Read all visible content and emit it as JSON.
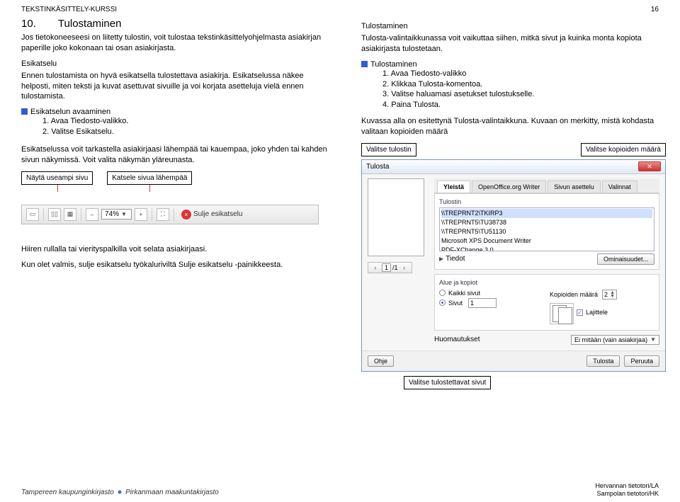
{
  "header": {
    "course": "TEKSTINKÄSITTELY-KURSSI",
    "page": "16"
  },
  "section": {
    "number": "10.",
    "title": "Tulostaminen",
    "intro": "Jos tietokoneeseesi on liitetty tulostin, voit tulostaa tekstinkäsittelyohjelmasta asiakirjan paperille joko kokonaan tai osan asiakirjasta."
  },
  "esikatselu": {
    "heading": "Esikatselu",
    "p1": "Ennen tulostamista on hyvä esikatsella tulostettava asiakirja. Esikatselussa näkee helposti, miten teksti ja kuvat asettuvat sivuille ja voi korjata asetteluja vielä ennen tulostamista.",
    "open_heading": "Esikatselun avaaminen",
    "steps": {
      "s1": "1.  Avaa Tiedosto-valikko.",
      "s2": "2.  Valitse Esikatselu."
    },
    "p2": "Esikatselussa voit tarkastella asiakirjaasi lähempää tai kauempaa, joko yhden tai kahden sivun näkymissä. Voit valita näkymän yläreunasta.",
    "callout1": "Näytä useampi sivu",
    "callout2": "Katsele sivua lähempää",
    "p3": "Hiiren rullalla tai vierityspalkilla voit selata asiakirjaasi.",
    "p4": "Kun olet valmis, sulje esikatselu työkaluriviltä Sulje esikatselu -painikkeesta."
  },
  "tulostaminen": {
    "heading": "Tulostaminen",
    "p1": "Tulosta-valintaikkunassa voit vaikuttaa siihen, mitkä sivut ja kuinka monta kopiota asiakirjasta tulostetaan.",
    "list_heading": "Tulostaminen",
    "steps": {
      "s1": "1.  Avaa Tiedosto-valikko",
      "s2": "2.  Klikkaa Tulosta-komentoa.",
      "s3": "3.  Valitse haluamasi asetukset tulostukselle.",
      "s4": "4.  Paina Tulosta."
    },
    "p2": "Kuvassa alla on esitettynä Tulosta-valintaikkuna. Kuvaan on merkitty, mistä kohdasta valitaan kopioiden määrä",
    "callout_left": "Valitse tulostin",
    "callout_right": "Valitse kopioiden määrä",
    "callout_bottom": "Valitse tulostettavat sivut"
  },
  "toolbar": {
    "zoom": "74%",
    "close_label": "Sulje esikatselu"
  },
  "pagecounter": {
    "value": "1",
    "total": "/1"
  },
  "dialog": {
    "title": "Tulosta",
    "tabs": {
      "t1": "Yleistä",
      "t2": "OpenOffice.org Writer",
      "t3": "Sivun asettelu",
      "t4": "Valinnat"
    },
    "group_printer": "Tulostin",
    "printers": {
      "p1": "\\\\TREPRNT2\\TKIRP3",
      "p2": "\\\\TREPRNT5\\TU38738",
      "p3": "\\\\TREPRNT5\\TU51130",
      "p4": "Microsoft XPS Document Writer",
      "p5": "PDF-XChange 3.0"
    },
    "details": "Tiedot",
    "properties": "Ominaisuudet...",
    "group_area": "Alue ja kopiot",
    "radio_all": "Kaikki sivut",
    "radio_pages": "Sivut",
    "pages_value": "1",
    "copies_label": "Kopioiden määrä",
    "copies_value": "2",
    "collate": "Lajittele",
    "group_notes": "Huomautukset",
    "notes_value": "Ei mitään (vain asiakirjaa)",
    "btn_help": "Ohje",
    "btn_print": "Tulosta",
    "btn_cancel": "Peruuta"
  },
  "footer": {
    "line1": "Hervannan tietotori/LA",
    "line2": "Sampolan tietotori/HK",
    "logo1": "Tampereen kaupunginkirjasto",
    "logo2": "Pirkanmaan maakuntakirjasto"
  }
}
